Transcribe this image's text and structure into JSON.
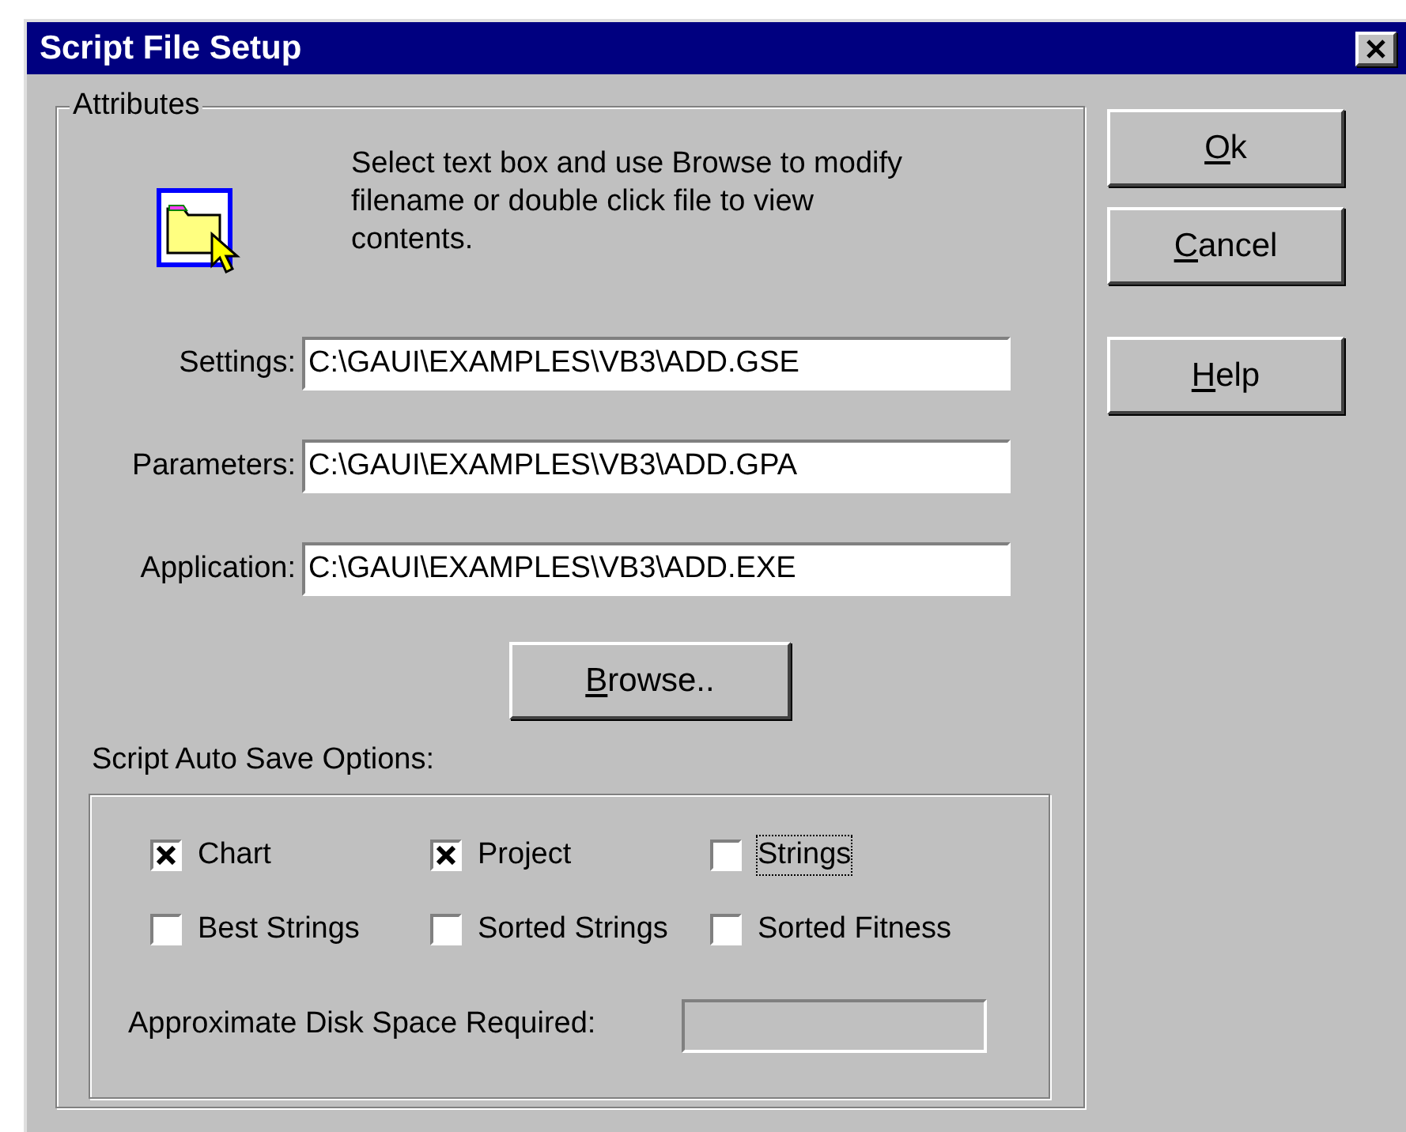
{
  "window": {
    "title": "Script File Setup"
  },
  "attributes": {
    "legend": "Attributes",
    "instructions": "Select text box and use Browse to modify filename or double click file to view contents.",
    "fields": [
      {
        "label": "Settings:",
        "value": "C:\\GAUI\\EXAMPLES\\VB3\\ADD.GSE"
      },
      {
        "label": "Parameters:",
        "value": "C:\\GAUI\\EXAMPLES\\VB3\\ADD.GPA"
      },
      {
        "label": "Application:",
        "value": "C:\\GAUI\\EXAMPLES\\VB3\\ADD.EXE"
      }
    ],
    "browse_button": {
      "label": "Browse..",
      "underline_first": true
    }
  },
  "auto_save": {
    "label": "Script Auto Save Options:",
    "options": [
      {
        "label": "Chart",
        "checked": true,
        "focused": false
      },
      {
        "label": "Project",
        "checked": true,
        "focused": false
      },
      {
        "label": "Strings",
        "checked": false,
        "focused": true
      },
      {
        "label": "Best Strings",
        "checked": false,
        "focused": false
      },
      {
        "label": "Sorted Strings",
        "checked": false,
        "focused": false
      },
      {
        "label": "Sorted Fitness",
        "checked": false,
        "focused": false
      }
    ],
    "disk_space": {
      "label": "Approximate Disk Space Required:"
    }
  },
  "buttons": [
    {
      "label": "Ok",
      "underline_first": true
    },
    {
      "label": "Cancel",
      "underline_first": true
    },
    {
      "label": "Help",
      "underline_first": true
    }
  ]
}
